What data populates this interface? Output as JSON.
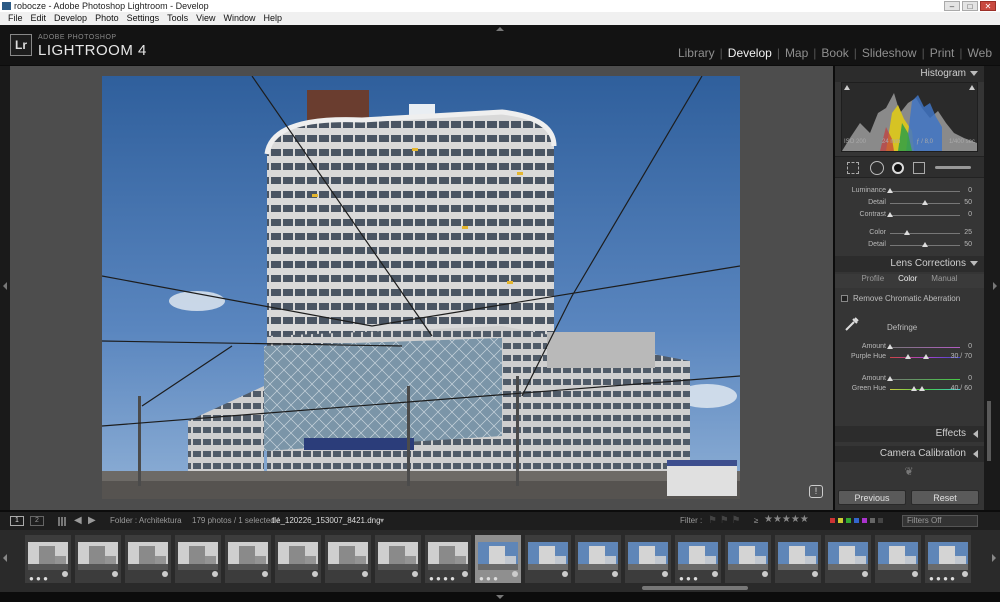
{
  "window": {
    "title": "robocze - Adobe Photoshop Lightroom - Develop",
    "controls": [
      "–",
      "□",
      "✕"
    ]
  },
  "menu": [
    "File",
    "Edit",
    "Develop",
    "Photo",
    "Settings",
    "Tools",
    "View",
    "Window",
    "Help"
  ],
  "identity": {
    "logo": "Lr",
    "brand_small": "ADOBE PHOTOSHOP",
    "brand_big": "LIGHTROOM 4"
  },
  "modules": [
    {
      "label": "Library",
      "active": false
    },
    {
      "label": "Develop",
      "active": true
    },
    {
      "label": "Map",
      "active": false
    },
    {
      "label": "Book",
      "active": false
    },
    {
      "label": "Slideshow",
      "active": false
    },
    {
      "label": "Print",
      "active": false
    },
    {
      "label": "Web",
      "active": false
    }
  ],
  "histogram": {
    "title": "Histogram",
    "iso": "ISO 200",
    "focal": "24 mm",
    "aperture": "ƒ / 8,0",
    "shutter": "1/400 sec"
  },
  "detail": {
    "luminance": {
      "label": "Luminance",
      "value": "0",
      "pos": 0.0
    },
    "detail1": {
      "label": "Detail",
      "value": "50",
      "pos": 0.5
    },
    "contrast": {
      "label": "Contrast",
      "value": "0",
      "pos": 0.0
    },
    "color": {
      "label": "Color",
      "value": "25",
      "pos": 0.25
    },
    "detail2": {
      "label": "Detail",
      "value": "50",
      "pos": 0.5
    }
  },
  "lens": {
    "title": "Lens Corrections",
    "tabs": [
      "Profile",
      "Color",
      "Manual"
    ],
    "remove_ca": "Remove Chromatic Aberration",
    "defringe": "Defringe",
    "amount1": {
      "label": "Amount",
      "value": "0"
    },
    "purple_hue": {
      "label": "Purple Hue",
      "value": "30 / 70"
    },
    "amount2": {
      "label": "Amount",
      "value": "0"
    },
    "green_hue": {
      "label": "Green Hue",
      "value": "40 / 60"
    }
  },
  "panels": {
    "effects": "Effects",
    "camera_calibration": "Camera Calibration"
  },
  "buttons": {
    "previous": "Previous",
    "reset": "Reset"
  },
  "filmbar": {
    "view1": "1",
    "view2": "2",
    "folder": "Folder : Architektura",
    "count": "179 photos / 1 selected /",
    "filename": "tle_120226_153007_8421.dng",
    "filter_label": "Filter :",
    "rating_op": "≥",
    "filters_off": "Filters Off"
  },
  "colors": {
    "accent": "#e8e8e8",
    "panel": "#353535",
    "center": "#4d4d4d",
    "sky": "#3f6ba0"
  },
  "filmstrip": {
    "thumbs": [
      {
        "kind": "bw",
        "dots": "● ● ●"
      },
      {
        "kind": "bw",
        "dots": ""
      },
      {
        "kind": "bw",
        "dots": ""
      },
      {
        "kind": "bw",
        "dots": ""
      },
      {
        "kind": "bw",
        "dots": ""
      },
      {
        "kind": "bw",
        "dots": ""
      },
      {
        "kind": "bw",
        "dots": ""
      },
      {
        "kind": "bw",
        "dots": ""
      },
      {
        "kind": "bw",
        "dots": "● ● ● ●"
      },
      {
        "kind": "color",
        "dots": "● ● ●",
        "selected": true
      },
      {
        "kind": "color",
        "dots": ""
      },
      {
        "kind": "color",
        "dots": ""
      },
      {
        "kind": "color",
        "dots": ""
      },
      {
        "kind": "color",
        "dots": "● ● ●"
      },
      {
        "kind": "color",
        "dots": ""
      },
      {
        "kind": "color",
        "dots": ""
      },
      {
        "kind": "color",
        "dots": ""
      },
      {
        "kind": "color",
        "dots": ""
      },
      {
        "kind": "color",
        "dots": "● ● ● ●"
      }
    ]
  }
}
